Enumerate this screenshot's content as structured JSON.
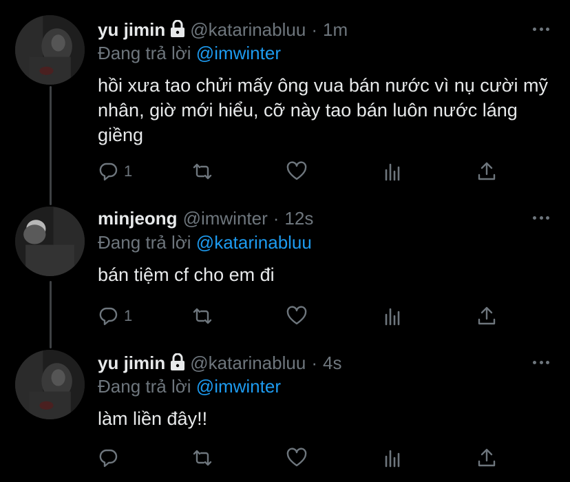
{
  "tweets": [
    {
      "name": "yu jimin",
      "locked": true,
      "handle": "@katarinabluu",
      "dot": "·",
      "time": "1m",
      "reply_prefix": "Đang trả lời",
      "reply_to": "@imwinter",
      "text": "hồi xưa tao chửi mấy ông vua bán nước vì nụ cười mỹ nhân, giờ mới hiểu, cỡ này tao bán luôn nước láng giềng",
      "reply_count": "1"
    },
    {
      "name": "minjeong",
      "locked": false,
      "handle": "@imwinter",
      "dot": "·",
      "time": "12s",
      "reply_prefix": "Đang trả lời",
      "reply_to": "@katarinabluu",
      "text": "bán tiệm cf cho em đi",
      "reply_count": "1"
    },
    {
      "name": "yu jimin",
      "locked": true,
      "handle": "@katarinabluu",
      "dot": "·",
      "time": "4s",
      "reply_prefix": "Đang trả lời",
      "reply_to": "@imwinter",
      "text": "làm liền đây!!",
      "reply_count": ""
    }
  ],
  "colors": {
    "background": "#000000",
    "text": "#e7e9ea",
    "muted": "#6e767d",
    "accent": "#1d9bf0",
    "thread_line": "#3e4144"
  },
  "icons": [
    "lock-icon",
    "more-icon",
    "reply-icon",
    "retweet-icon",
    "like-icon",
    "analytics-icon",
    "share-icon"
  ]
}
